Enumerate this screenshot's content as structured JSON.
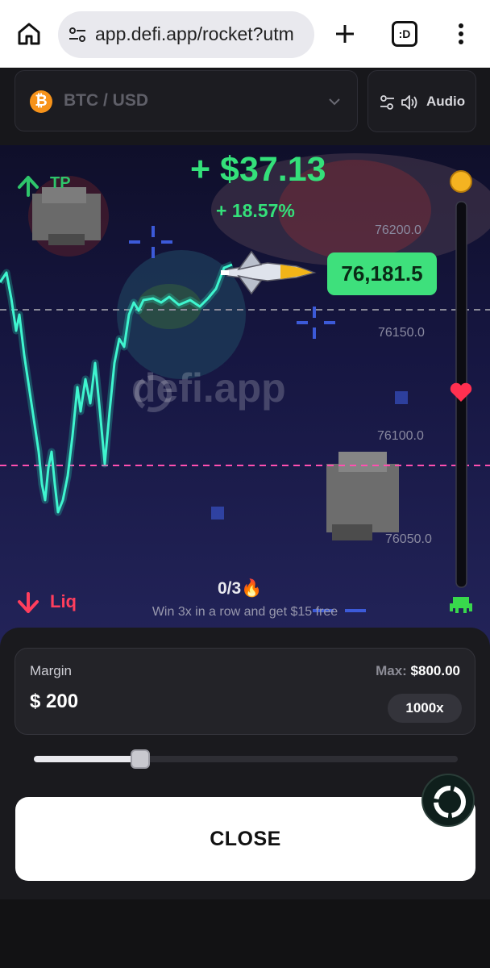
{
  "browser": {
    "url": "app.defi.app/rocket?utm",
    "tabs_count": ":D"
  },
  "header": {
    "pair_icon_symbol": "₿",
    "pair": "BTC / USD",
    "audio_label": "Audio"
  },
  "game": {
    "tp_label": "TP",
    "pnl_value": "+ $37.13",
    "pnl_percent": "+ 18.57%",
    "price_ticks": [
      "76200.0",
      "76150.0",
      "76100.0",
      "76050.0"
    ],
    "current_price": "76,181.5",
    "watermark": "defi.app",
    "liq_label": "Liq",
    "streak": "0/3🔥",
    "streak_text": "Win 3x in a row and get $15 free",
    "colors": {
      "line": "#29f2c4",
      "tp_line": "#8a8a99",
      "liq_line": "#ff4fb0",
      "profit": "#34e07a",
      "loss": "#ff3e5d"
    }
  },
  "panel": {
    "margin_label": "Margin",
    "margin_value": "$ 200",
    "max_label": "Max:",
    "max_value": "$800.00",
    "leverage": "1000x",
    "slider_fraction": 0.25,
    "close_label": "CLOSE"
  }
}
